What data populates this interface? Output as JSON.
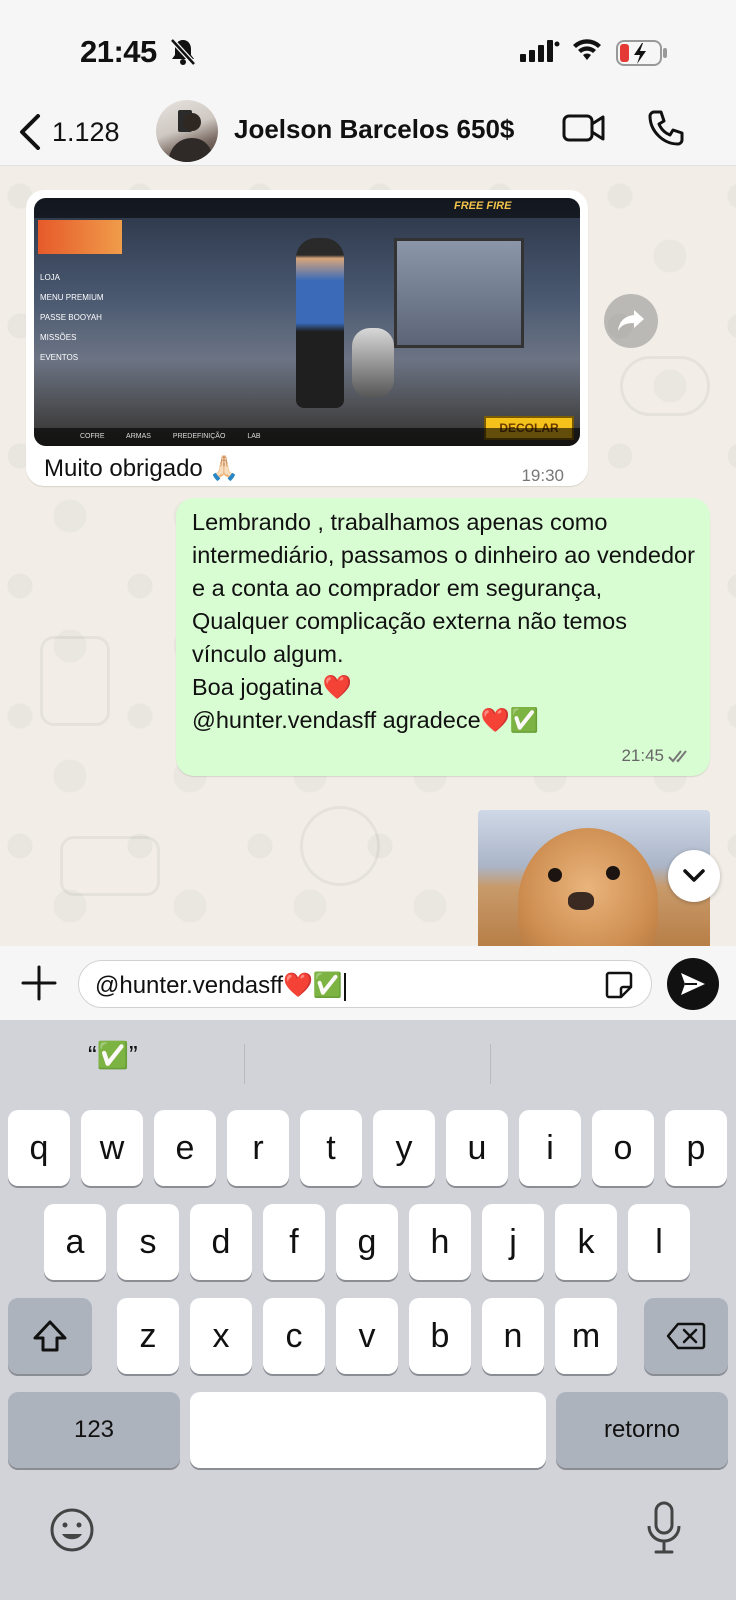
{
  "status": {
    "time": "21:45"
  },
  "header": {
    "back_count": "1.128",
    "contact_name": "Joelson Barcelos 650$"
  },
  "game_image": {
    "logo": "FREE FIRE",
    "menu": [
      "LOJA",
      "MENU PREMIUM",
      "PASSE BOOYAH",
      "MISSÕES",
      "EVENTOS"
    ],
    "play_button": "DECOLAR",
    "bottom_bar": "COFRE ARMAS PREDEFINIÇÃO LAB"
  },
  "messages": [
    {
      "type": "incoming",
      "caption": "Muito obrigado 🙏🏻",
      "time": "19:30"
    },
    {
      "type": "outgoing",
      "text": "Lembrando , trabalhamos apenas como intermediário, passamos o dinheiro ao vendedor e a conta ao comprador em segurança,\nQualquer complicação externa não temos vínculo algum.\nBoa jogatina❤️\n@hunter.vendasff agradece❤️✅",
      "time": "21:45"
    }
  ],
  "composer": {
    "text": "@hunter.vendasff❤️✅"
  },
  "keyboard": {
    "suggestion": "“✅”",
    "row1": [
      "q",
      "w",
      "e",
      "r",
      "t",
      "y",
      "u",
      "i",
      "o",
      "p"
    ],
    "row2": [
      "a",
      "s",
      "d",
      "f",
      "g",
      "h",
      "j",
      "k",
      "l"
    ],
    "row3": [
      "z",
      "x",
      "c",
      "v",
      "b",
      "n",
      "m"
    ],
    "numbers_label": "123",
    "return_label": "retorno"
  }
}
